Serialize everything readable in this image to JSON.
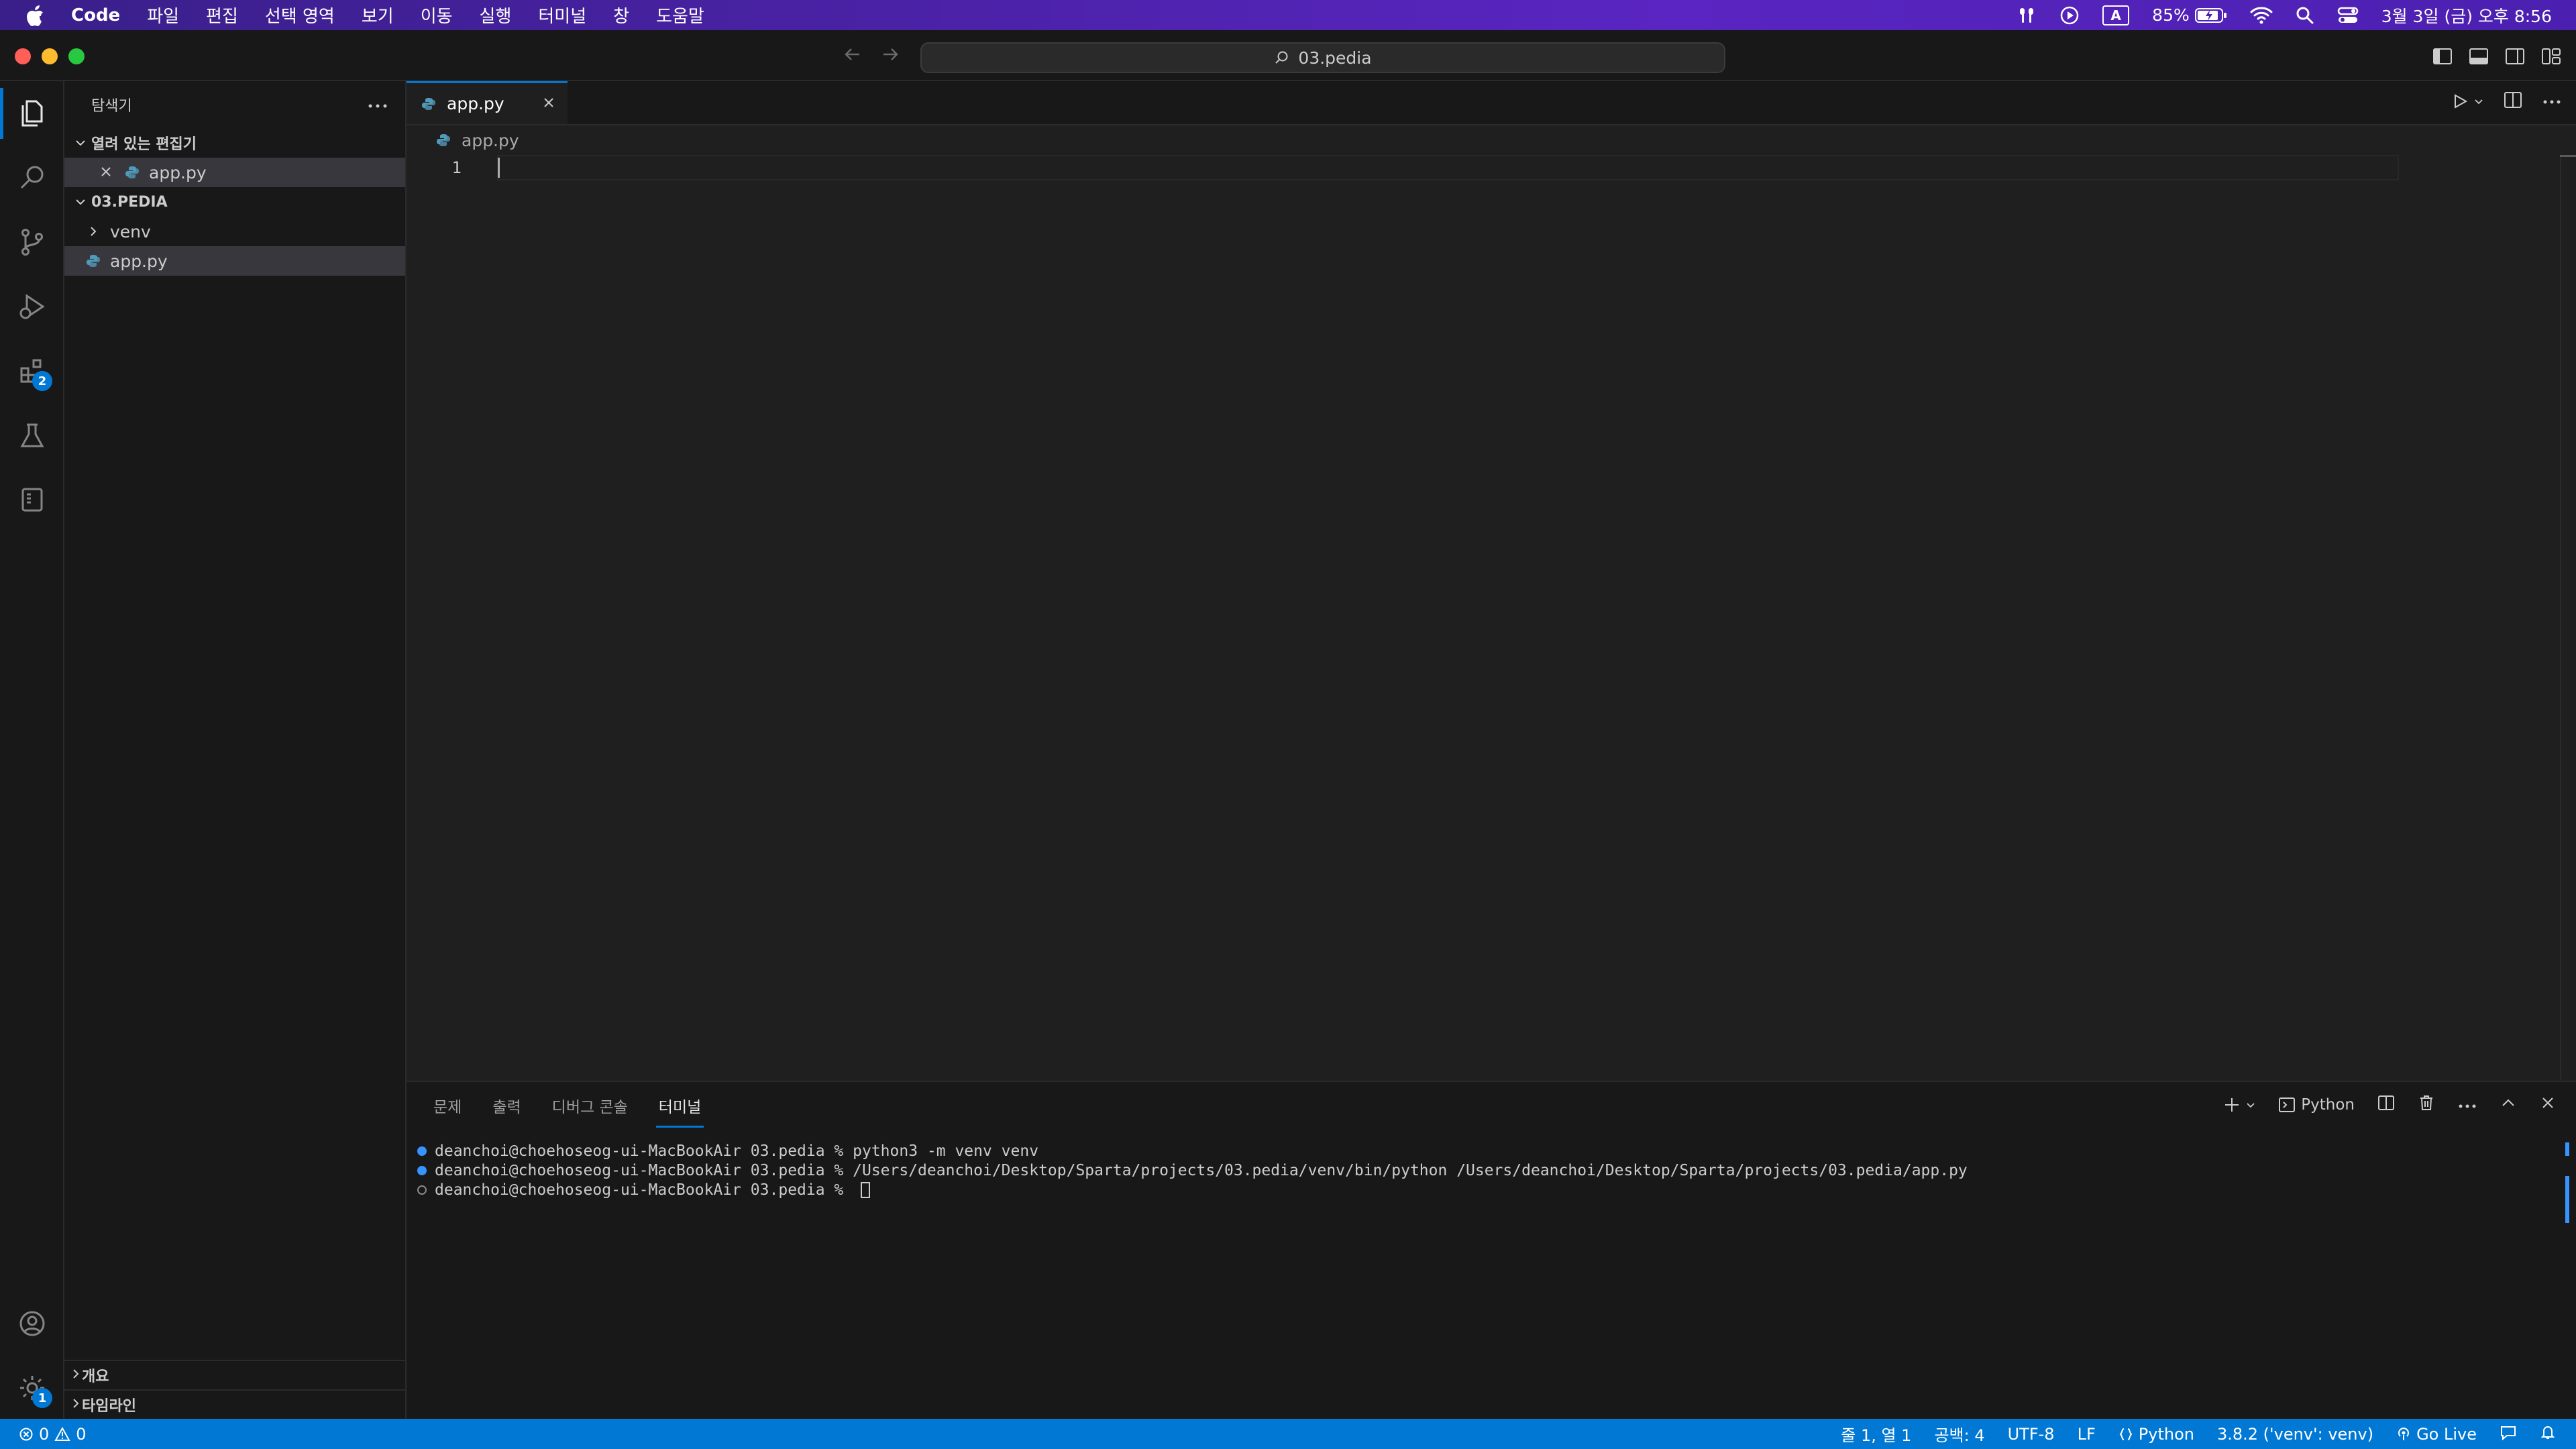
{
  "menubar": {
    "app_name": "Code",
    "items": [
      "파일",
      "편집",
      "선택 영역",
      "보기",
      "이동",
      "실행",
      "터미널",
      "창",
      "도움말"
    ],
    "battery": "85%",
    "input_indicator": "A",
    "datetime": "3월 3일 (금) 오후 8:56"
  },
  "window": {
    "search_label": "03.pedia"
  },
  "activitybar": {
    "extensions_badge": "2",
    "settings_badge": "1"
  },
  "sidebar": {
    "title": "탐색기",
    "open_editors_label": "열려 있는 편집기",
    "open_editor_file": "app.py",
    "folder_label": "03.PEDIA",
    "items": [
      {
        "label": "venv"
      },
      {
        "label": "app.py"
      }
    ],
    "outline_label": "개요",
    "timeline_label": "타임라인"
  },
  "editor": {
    "tab_label": "app.py",
    "breadcrumb": "app.py",
    "line_number": "1"
  },
  "panel": {
    "tabs": [
      "문제",
      "출력",
      "디버그 콘솔",
      "터미널"
    ],
    "shell_label": "Python",
    "terminal_lines": [
      "deanchoi@choehoseog-ui-MacBookAir 03.pedia % python3 -m venv venv",
      "deanchoi@choehoseog-ui-MacBookAir 03.pedia % /Users/deanchoi/Desktop/Sparta/projects/03.pedia/venv/bin/python /Users/deanchoi/Desktop/Sparta/projects/03.pedia/app.py",
      "deanchoi@choehoseog-ui-MacBookAir 03.pedia % "
    ]
  },
  "statusbar": {
    "errors": "0",
    "warnings": "0",
    "position": "줄 1, 열 1",
    "spaces": "공백: 4",
    "encoding": "UTF-8",
    "eol": "LF",
    "language": "Python",
    "interpreter": "3.8.2 ('venv': venv)",
    "go_live": "Go Live"
  },
  "colors": {
    "accent": "#0078d4",
    "statusbar": "#0078d4",
    "editor_bg": "#1f1f1f",
    "sidebar_bg": "#181818"
  }
}
